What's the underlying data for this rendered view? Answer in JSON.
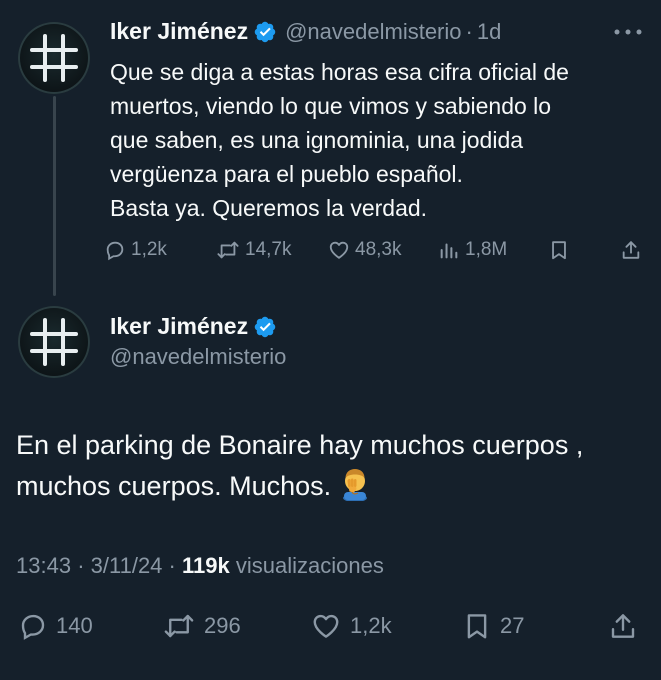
{
  "colors": {
    "background": "#15202b",
    "text_primary": "#f7f9f9",
    "text_secondary": "#8b98a5",
    "verified_blue": "#1d9bf0",
    "thread_line": "#38444d"
  },
  "reply_tweet": {
    "author": {
      "display_name": "Iker Jiménez",
      "handle": "@navedelmisterio",
      "verified": true,
      "avatar_icon": "hashtag-grid-avatar"
    },
    "separator": "·",
    "time_relative": "1d",
    "more_icon": "more-dots-icon",
    "text_lines": [
      "Que se diga a estas horas esa cifra oficial de",
      "muertos, viendo lo que vimos y sabiendo lo",
      "que saben, es una ignominia, una jodida",
      "vergüenza para el pueblo español.",
      "Basta ya. Queremos la verdad."
    ],
    "actions": {
      "replies": "1,2k",
      "retweets": "14,7k",
      "likes": "48,3k",
      "views": "1,8M"
    }
  },
  "main_tweet": {
    "author": {
      "display_name": "Iker Jiménez",
      "handle": "@navedelmisterio",
      "verified": true,
      "avatar_icon": "hashtag-grid-avatar"
    },
    "text_lines": [
      "En el parking de Bonaire hay muchos cuerpos ,",
      "muchos cuerpos. Muchos."
    ],
    "emoji": "person-facepalming",
    "meta": {
      "time": "13:43",
      "sep1": "·",
      "date": "3/11/24",
      "sep2": "·",
      "views_count": "119k",
      "views_label": "visualizaciones"
    },
    "actions": {
      "replies": "140",
      "retweets": "296",
      "likes": "1,2k",
      "bookmarks": "27"
    }
  }
}
